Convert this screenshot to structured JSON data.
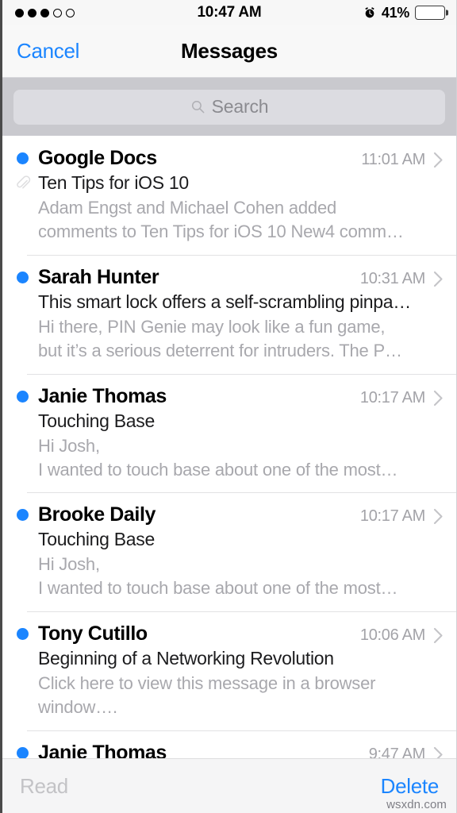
{
  "status_bar": {
    "signal_dots_filled": 3,
    "signal_dots_total": 5,
    "time": "10:47 AM",
    "alarm_icon": "alarm-clock-icon",
    "battery_percent": "41%",
    "battery_level": 41,
    "battery_color": "#ffcc00"
  },
  "nav": {
    "cancel_label": "Cancel",
    "title": "Messages"
  },
  "search": {
    "placeholder": "Search",
    "value": "",
    "icon": "search-icon"
  },
  "colors": {
    "accent_blue": "#1b85ff",
    "unread_dot": "#1b85ff",
    "battery_yellow": "#ffcc00",
    "search_band": "#c9c9ce",
    "search_field": "#dcdce1",
    "nav_bg": "#f8f8f8",
    "toolbar_bg": "#f5f5f6",
    "preview_text": "#a8a8ad",
    "time_text": "#a3a3a8"
  },
  "mail_list": [
    {
      "unread": true,
      "sender": "Google Docs",
      "time": "11:01 AM",
      "has_attachment": true,
      "subject": "Ten Tips for iOS 10",
      "preview_lines": [
        "Adam Engst and Michael Cohen added",
        "comments to Ten Tips for iOS 10 New4 comm…"
      ]
    },
    {
      "unread": true,
      "sender": "Sarah Hunter",
      "time": "10:31 AM",
      "has_attachment": false,
      "subject": "This smart lock offers a self-scrambling pinpa…",
      "preview_lines": [
        "Hi there, PIN Genie may look like a fun game,",
        "but it’s a serious deterrent for intruders. The P…"
      ]
    },
    {
      "unread": true,
      "sender": "Janie Thomas",
      "time": "10:17 AM",
      "has_attachment": false,
      "subject": "Touching Base",
      "preview_lines": [
        "Hi Josh,",
        "I wanted to touch base about one of the most…"
      ]
    },
    {
      "unread": true,
      "sender": "Brooke Daily",
      "time": "10:17 AM",
      "has_attachment": false,
      "subject": "Touching Base",
      "preview_lines": [
        "Hi Josh,",
        "I wanted to touch base about one of the most…"
      ]
    },
    {
      "unread": true,
      "sender": "Tony Cutillo",
      "time": "10:06 AM",
      "has_attachment": false,
      "subject": "Beginning of a Networking Revolution",
      "preview_lines": [
        "Click here to view this message in a browser",
        "window…."
      ]
    },
    {
      "unread": true,
      "sender": "Janie Thomas",
      "time": "9:47 AM",
      "has_attachment": false,
      "subject": "",
      "preview_lines": []
    }
  ],
  "toolbar": {
    "read_label": "Read",
    "delete_label": "Delete"
  },
  "watermark": "wsxdn.com"
}
